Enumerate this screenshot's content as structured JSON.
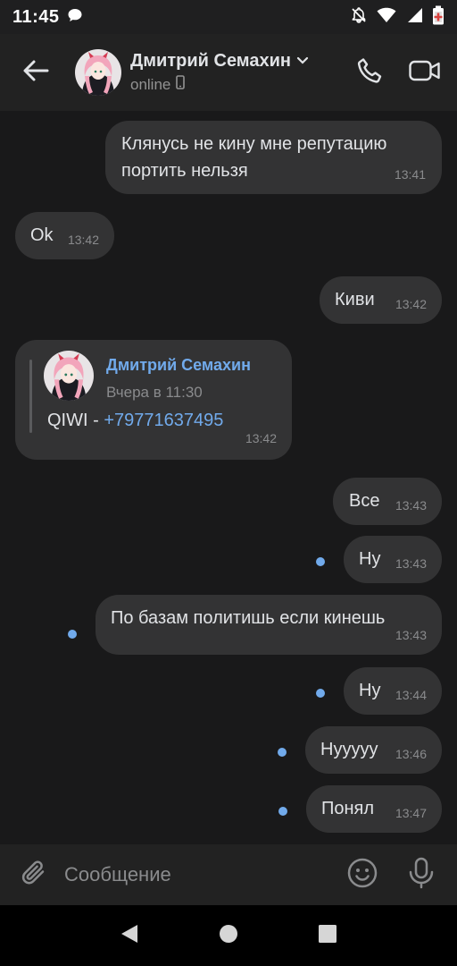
{
  "status_bar": {
    "time": "11:45",
    "icons": [
      "chat-bubble-icon",
      "bell-off-icon",
      "wifi-icon",
      "signal-icon",
      "battery-icon"
    ]
  },
  "header": {
    "contact_name": "Дмитрий Семахин",
    "status": "online",
    "icons": [
      "back-arrow-icon",
      "chevron-down-icon",
      "phone-device-icon",
      "phone-icon",
      "video-icon"
    ]
  },
  "messages": [
    {
      "direction": "out",
      "lines": [
        "Клянусь не кину мне репутацию",
        "портить нельзя"
      ],
      "time": "13:41",
      "unread": false
    },
    {
      "direction": "in",
      "lines": [
        "Ok"
      ],
      "time": "13:42",
      "unread": false
    },
    {
      "direction": "out",
      "lines": [
        "Киви"
      ],
      "time": "13:42",
      "unread": false
    },
    {
      "direction": "in",
      "type": "forward",
      "forward": {
        "author": "Дмитрий Семахин",
        "date": "Вчера в 11:30",
        "text_prefix": "QIWI - ",
        "link": "+79771637495"
      },
      "time": "13:42",
      "unread": false
    },
    {
      "direction": "out",
      "lines": [
        "Все"
      ],
      "time": "13:43",
      "unread": false
    },
    {
      "direction": "out",
      "lines": [
        "Ну"
      ],
      "time": "13:43",
      "unread": true
    },
    {
      "direction": "out",
      "lines": [
        "По базам политишь если кинешь"
      ],
      "time": "13:43",
      "unread": true
    },
    {
      "direction": "out",
      "lines": [
        "Ну"
      ],
      "time": "13:44",
      "unread": true
    },
    {
      "direction": "out",
      "lines": [
        "Нууууу"
      ],
      "time": "13:46",
      "unread": true
    },
    {
      "direction": "out",
      "lines": [
        "Понял"
      ],
      "time": "13:47",
      "unread": true
    }
  ],
  "composer": {
    "placeholder": "Сообщение",
    "icons": [
      "paperclip-icon",
      "emoji-icon",
      "microphone-icon"
    ]
  },
  "nav_bar": {
    "icons": [
      "nav-back-icon",
      "nav-home-icon",
      "nav-recents-icon"
    ]
  },
  "colors": {
    "background": "#19191a",
    "bubble": "#333334",
    "accent": "#71aaeb",
    "muted": "#8a8b8d"
  }
}
